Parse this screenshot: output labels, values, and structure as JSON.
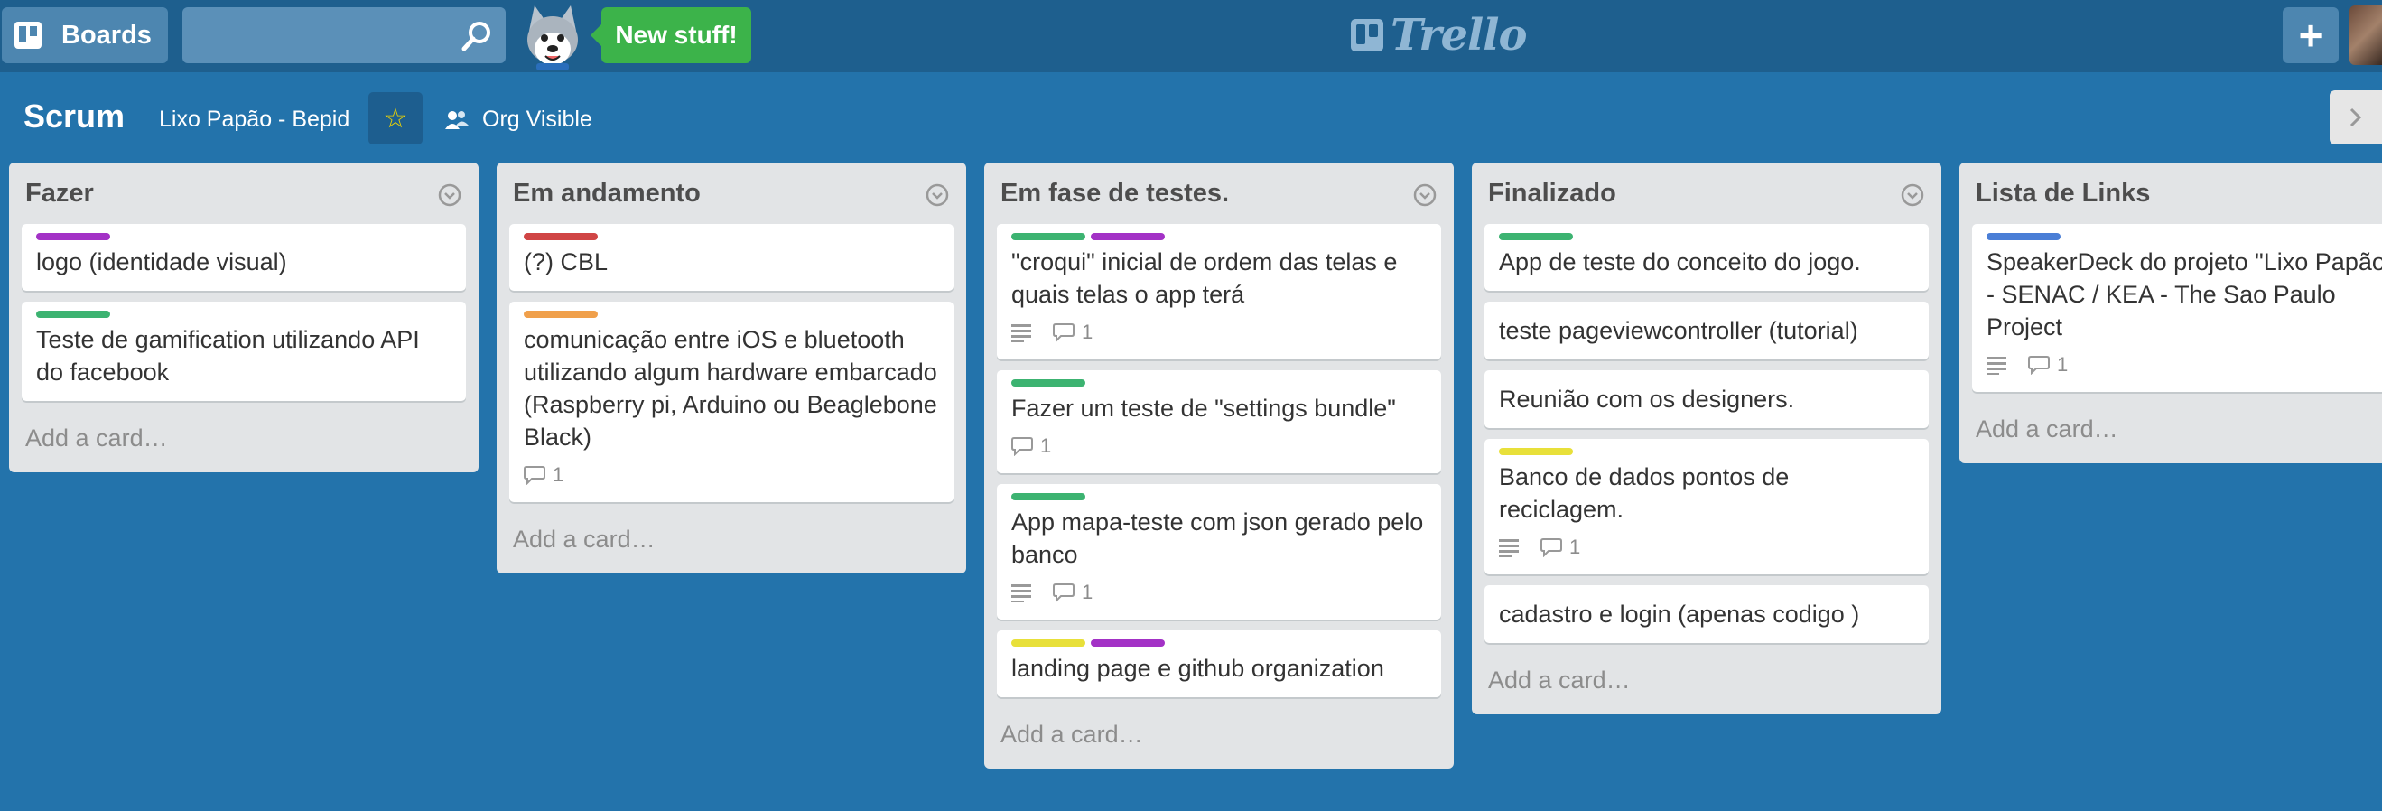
{
  "header": {
    "boards_label": "Boards",
    "search_value": "",
    "new_stuff_label": "New stuff!",
    "logo_text": "Trello",
    "plus_label": "+"
  },
  "board": {
    "title": "Scrum",
    "org": "Lixo Papão - Bepid",
    "visibility": "Org Visible"
  },
  "lists": [
    {
      "title": "Fazer",
      "add": "Add a card…",
      "cards": [
        {
          "labels": [
            "#a332c6"
          ],
          "title": "logo (identidade visual)",
          "desc": false,
          "comments": ""
        },
        {
          "labels": [
            "#3cb371"
          ],
          "title": "Teste de gamification utilizando API do facebook",
          "desc": false,
          "comments": ""
        }
      ]
    },
    {
      "title": "Em andamento",
      "add": "Add a card…",
      "cards": [
        {
          "labels": [
            "#d04545"
          ],
          "title": "(?) CBL",
          "desc": false,
          "comments": ""
        },
        {
          "labels": [
            "#f0a04b"
          ],
          "title": "comunicação entre iOS e bluetooth utilizando algum hardware embarcado (Raspberry pi, Arduino ou Beaglebone Black)",
          "desc": false,
          "comments": "1"
        }
      ]
    },
    {
      "title": "Em fase de testes.",
      "add": "Add a card…",
      "cards": [
        {
          "labels": [
            "#3cb371",
            "#a332c6"
          ],
          "title": "\"croqui\" inicial de ordem das telas e quais telas o app terá",
          "desc": true,
          "comments": "1"
        },
        {
          "labels": [
            "#3cb371"
          ],
          "title": "Fazer um teste de \"settings bundle\"",
          "desc": false,
          "comments": "1"
        },
        {
          "labels": [
            "#3cb371"
          ],
          "title": "App mapa-teste com json gerado pelo banco",
          "desc": true,
          "comments": "1"
        },
        {
          "labels": [
            "#e8e03a",
            "#a332c6"
          ],
          "title": "landing page e github organization",
          "desc": false,
          "comments": ""
        }
      ]
    },
    {
      "title": "Finalizado",
      "add": "Add a card…",
      "cards": [
        {
          "labels": [
            "#3cb371"
          ],
          "title": "App de teste do conceito do jogo.",
          "desc": false,
          "comments": ""
        },
        {
          "labels": [],
          "title": "teste pageviewcontroller (tutorial)",
          "desc": false,
          "comments": ""
        },
        {
          "labels": [],
          "title": "Reunião com os designers.",
          "desc": false,
          "comments": ""
        },
        {
          "labels": [
            "#e8e03a"
          ],
          "title": "Banco de dados pontos de reciclagem.",
          "desc": true,
          "comments": "1"
        },
        {
          "labels": [],
          "title": "cadastro e login (apenas codigo )",
          "desc": false,
          "comments": ""
        }
      ]
    },
    {
      "title": "Lista de Links",
      "add": "Add a card…",
      "cards": [
        {
          "labels": [
            "#4a7ed6"
          ],
          "title": "SpeakerDeck do projeto \"Lixo Papão\" - SENAC / KEA - The Sao Paulo Project",
          "desc": true,
          "comments": "1"
        }
      ]
    }
  ],
  "icons": {
    "boards": "board-icon",
    "search": "search-icon",
    "mascot": "husky-mascot-icon",
    "star": "star-icon",
    "visibility": "org-members-icon",
    "menu": "list-menu-chevron-icon",
    "desc": "description-icon",
    "comment": "comment-icon"
  }
}
